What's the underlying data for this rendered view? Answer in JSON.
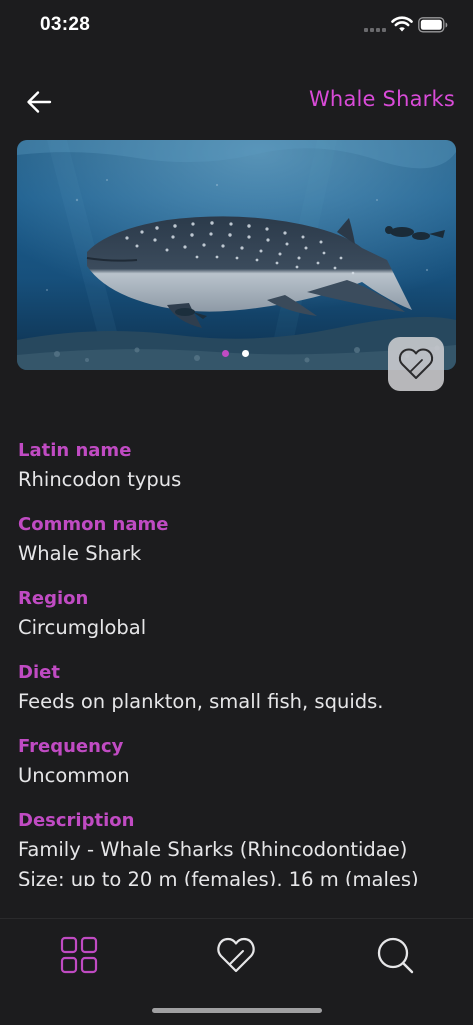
{
  "status_bar": {
    "time": "03:28"
  },
  "header": {
    "title": "Whale Sharks",
    "accent_color": "#d94bd8"
  },
  "gallery": {
    "pages": 2,
    "active_page": 1
  },
  "fields": [
    {
      "label": "Latin name",
      "value": "Rhincodon typus"
    },
    {
      "label": "Common name",
      "value": "Whale Shark"
    },
    {
      "label": "Region",
      "value": "Circumglobal"
    },
    {
      "label": "Diet",
      "value": "Feeds on plankton, small fish, squids."
    },
    {
      "label": "Frequency",
      "value": "Uncommon"
    },
    {
      "label": "Description",
      "value": "Family - Whale Sharks (Rhincodontidae)",
      "value_2": "Size: up to 20 m (females), 16 m (males)"
    }
  ],
  "tab_bar": {
    "active_tab": "catalog",
    "active_color": "#c04bc3",
    "inactive_color": "#e6e6e8"
  }
}
